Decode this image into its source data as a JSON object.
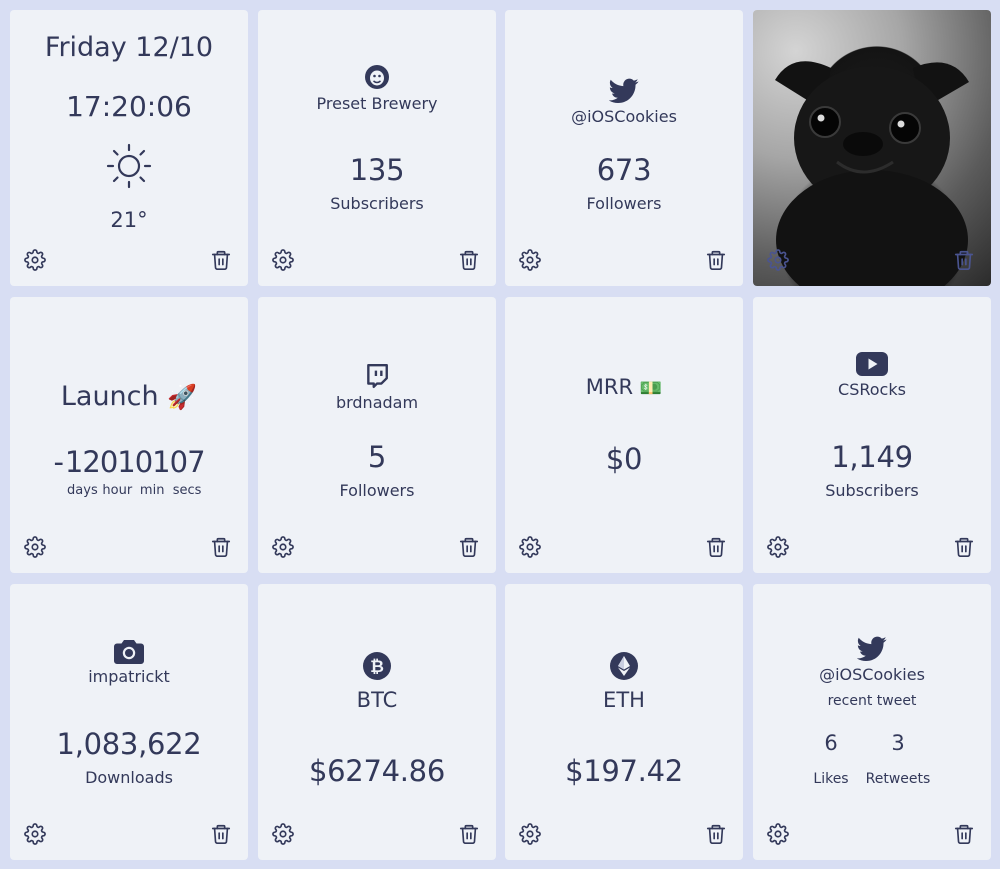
{
  "widgets": {
    "clock": {
      "date": "Friday 12/10",
      "time": "17:20:06",
      "temperature": "21°",
      "weather_icon": "sun-icon"
    },
    "mailchimp": {
      "name": "Preset Brewery",
      "value": "135",
      "label": "Subscribers",
      "icon": "mailchimp-icon"
    },
    "twitter": {
      "handle": "@iOSCookies",
      "value": "673",
      "label": "Followers",
      "icon": "twitter-bird-icon"
    },
    "photo": {
      "subject": "black-pug-photo"
    },
    "launch": {
      "title": "Launch",
      "emoji": "🚀",
      "sign": "-",
      "units": [
        {
          "value": "12",
          "label": "days"
        },
        {
          "value": "01",
          "label": "hour"
        },
        {
          "value": "01",
          "label": "min"
        },
        {
          "value": "07",
          "label": "secs"
        }
      ]
    },
    "twitch": {
      "name": "brdnadam",
      "value": "5",
      "label": "Followers",
      "icon": "twitch-icon"
    },
    "mrr": {
      "title": "MRR",
      "emoji": "💵",
      "value": "$0"
    },
    "youtube": {
      "name": "CSRocks",
      "value": "1,149",
      "label": "Subscribers",
      "icon": "youtube-icon"
    },
    "instagram": {
      "name": "impatrickt",
      "value": "1,083,622",
      "label": "Downloads",
      "icon": "camera-icon"
    },
    "btc": {
      "symbol": "BTC",
      "value": "$6274.86",
      "icon": "bitcoin-icon"
    },
    "eth": {
      "symbol": "ETH",
      "value": "$197.42",
      "icon": "ethereum-icon"
    },
    "tweet": {
      "handle": "@iOSCookies",
      "caption": "recent tweet",
      "likes_value": "6",
      "likes_label": "Likes",
      "retweets_value": "3",
      "retweets_label": "Retweets",
      "icon": "twitter-bird-icon"
    }
  },
  "controls": {
    "settings_icon": "gear-icon",
    "delete_icon": "trash-icon"
  },
  "colors": {
    "background": "#d8def3",
    "card": "#eff2f7",
    "text": "#33395a"
  }
}
